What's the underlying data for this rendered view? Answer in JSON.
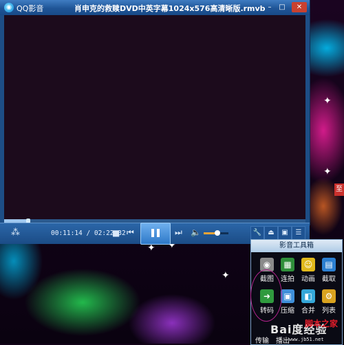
{
  "player": {
    "app_name": "QQ影音",
    "file_title": "肖申克的救赎DVD中英字幕1024x576高清晰版.rmvb",
    "progress_fraction": 0.08,
    "time_display": "00:11:14 / 02:22:32",
    "volume_fraction": 0.55,
    "buttons": {
      "minimize": "–",
      "maximize": "□",
      "close": "✕"
    }
  },
  "toolbox": {
    "title": "影音工具箱",
    "tools": [
      {
        "label": "截图",
        "icon": "camera-icon",
        "glyph": "◉",
        "color": "#8a8a8a"
      },
      {
        "label": "连拍",
        "icon": "grid-icon",
        "glyph": "▦",
        "color": "#2f8f3a"
      },
      {
        "label": "动画",
        "icon": "smile-icon",
        "glyph": "☺",
        "color": "#e0b81b"
      },
      {
        "label": "截取",
        "icon": "film-cut-icon",
        "glyph": "▤",
        "color": "#2b7fd1"
      },
      {
        "label": "转码",
        "icon": "convert-arrow-icon",
        "glyph": "➜",
        "color": "#2f9a3e"
      },
      {
        "label": "压缩",
        "icon": "compress-icon",
        "glyph": "▣",
        "color": "#3f8fd9"
      },
      {
        "label": "合并",
        "icon": "merge-icon",
        "glyph": "◧",
        "color": "#35a7d9"
      },
      {
        "label": "列表",
        "icon": "list-gear-icon",
        "glyph": "⚙",
        "color": "#d9a21f"
      }
    ],
    "bottom_labels": [
      "传输",
      "播出"
    ]
  },
  "watermark": {
    "text": "Bai度经验",
    "url": "www.jb51.net",
    "corner_logo": "脚本之家"
  },
  "side_badge": "至"
}
